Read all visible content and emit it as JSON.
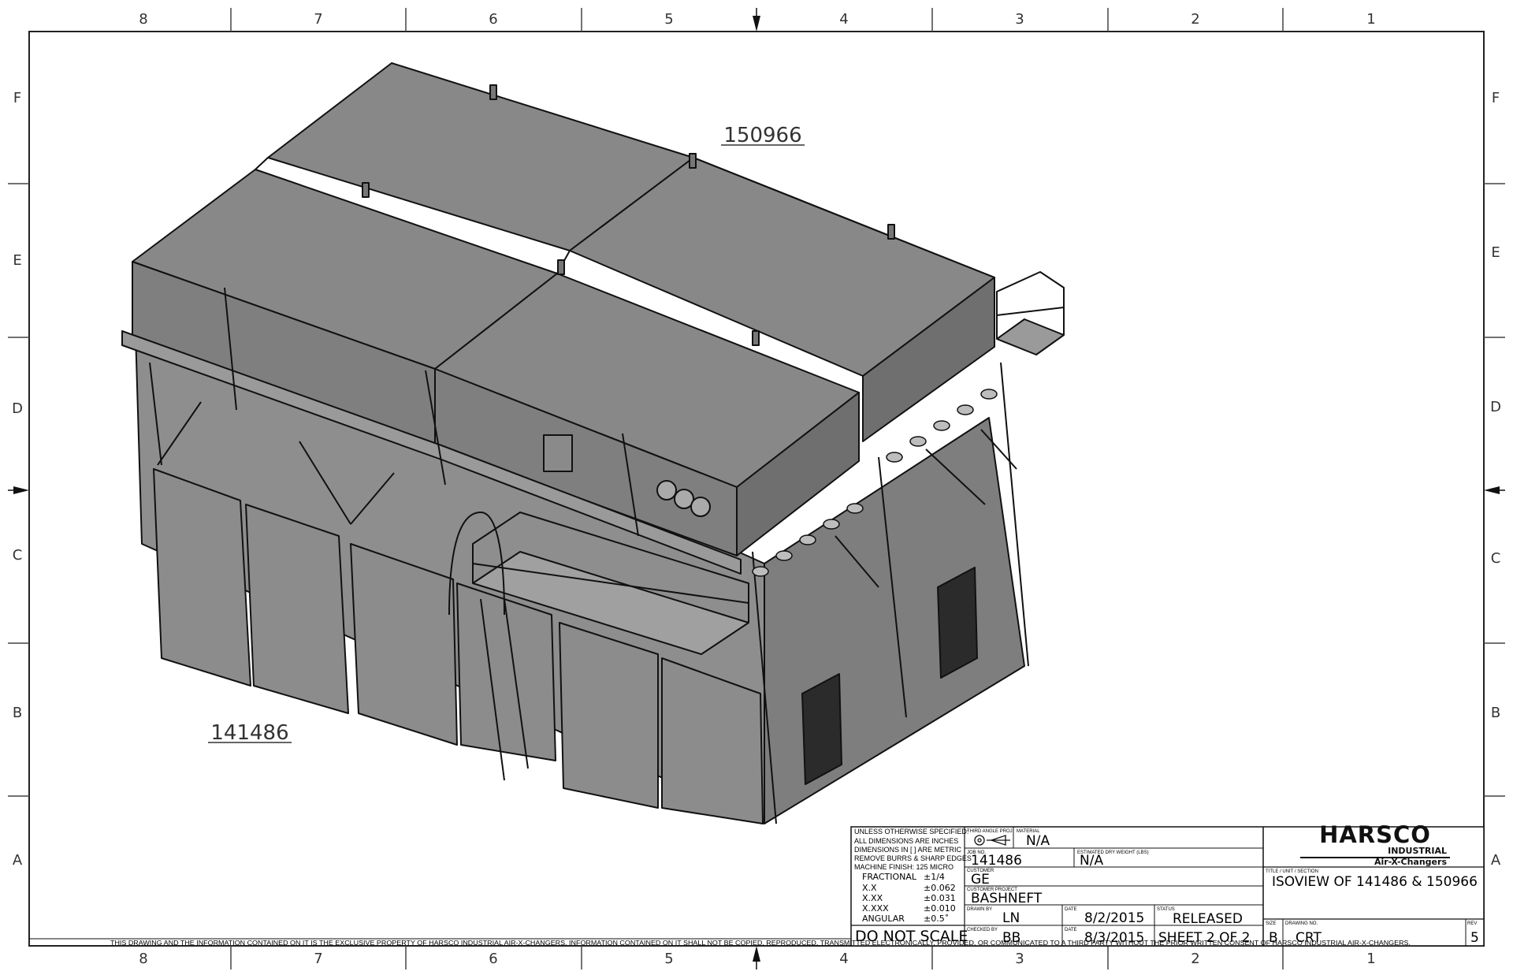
{
  "zones": {
    "columns_top": [
      "8",
      "7",
      "6",
      "5",
      "4",
      "3",
      "2",
      "1"
    ],
    "columns_bottom": [
      "8",
      "7",
      "6",
      "5",
      "4",
      "3",
      "2",
      "1"
    ],
    "rows_left": [
      "F",
      "E",
      "D",
      "C",
      "B",
      "A"
    ],
    "rows_right": [
      "F",
      "E",
      "D",
      "C",
      "B",
      "A"
    ]
  },
  "callouts": {
    "unit_top": "150966",
    "unit_bottom": "141486"
  },
  "title_block": {
    "notes": {
      "line1": "UNLESS OTHERWISE SPECIFIED:",
      "line2": "ALL DIMENSIONS ARE INCHES",
      "line3": "DIMENSIONS IN [ ] ARE METRIC",
      "line4": "REMOVE BURRS & SHARP EDGES",
      "line5": "MACHINE FINISH: 125 MICRO"
    },
    "tolerances": [
      {
        "label": "FRACTIONAL",
        "value": "±1/4"
      },
      {
        "label": "X.X",
        "value": "±0.062"
      },
      {
        "label": "X.XX",
        "value": "±0.031"
      },
      {
        "label": "X.XXX",
        "value": "±0.010"
      },
      {
        "label": "ANGULAR",
        "value": "±0.5˚"
      }
    ],
    "do_not_scale": "DO NOT SCALE",
    "projection_label": "THIRD ANGLE PROJ",
    "material_label": "MATERIAL",
    "material": "N/A",
    "job_no_label": "JOB NO.",
    "job_no": "141486",
    "weight_label": "ESTIMATED DRY WEIGHT (LBS)",
    "weight": "N/A",
    "customer_label": "CUSTOMER",
    "customer": "GE",
    "project_label": "CUSTOMER PROJECT",
    "project": "BASHNEFT",
    "drawn_by_label": "DRAWN BY",
    "drawn_by": "LN",
    "date_label": "DATE",
    "drawn_date": "8/2/2015",
    "status_label": "STATUS",
    "status": "RELEASED",
    "checked_by_label": "CHECKED BY",
    "checked_by": "BB",
    "checked_date": "8/3/2015",
    "sheet": "SHEET 2 OF 2",
    "company": "HARSCO",
    "division": "INDUSTRIAL",
    "product_line": "Air-X-Changers",
    "title_label": "TITLE / UNIT / SECTION",
    "title": "ISOVIEW OF 141486 & 150966",
    "size_label": "SIZE",
    "size": "B",
    "drawing_no_label": "DRAWING NO.",
    "drawing_no": "CRT",
    "rev_label": "REV",
    "rev": "5"
  },
  "disclaimer": "THIS DRAWING AND THE INFORMATION CONTAINED ON IT IS THE EXCLUSIVE PROPERTY OF HARSCO INDUSTRIAL AIR-X-CHANGERS.  INFORMATION CONTAINED ON IT SHALL NOT BE COPIED, REPRODUCED, TRANSMITTED ELECTRONICALLY, PROVIDED, OR COMMUNICATED TO A THIRD PARTY WITHOUT THE PRIOR WRITTEN CONSENT OF HARSCO INDUSTRIAL AIR-X-CHANGERS."
}
